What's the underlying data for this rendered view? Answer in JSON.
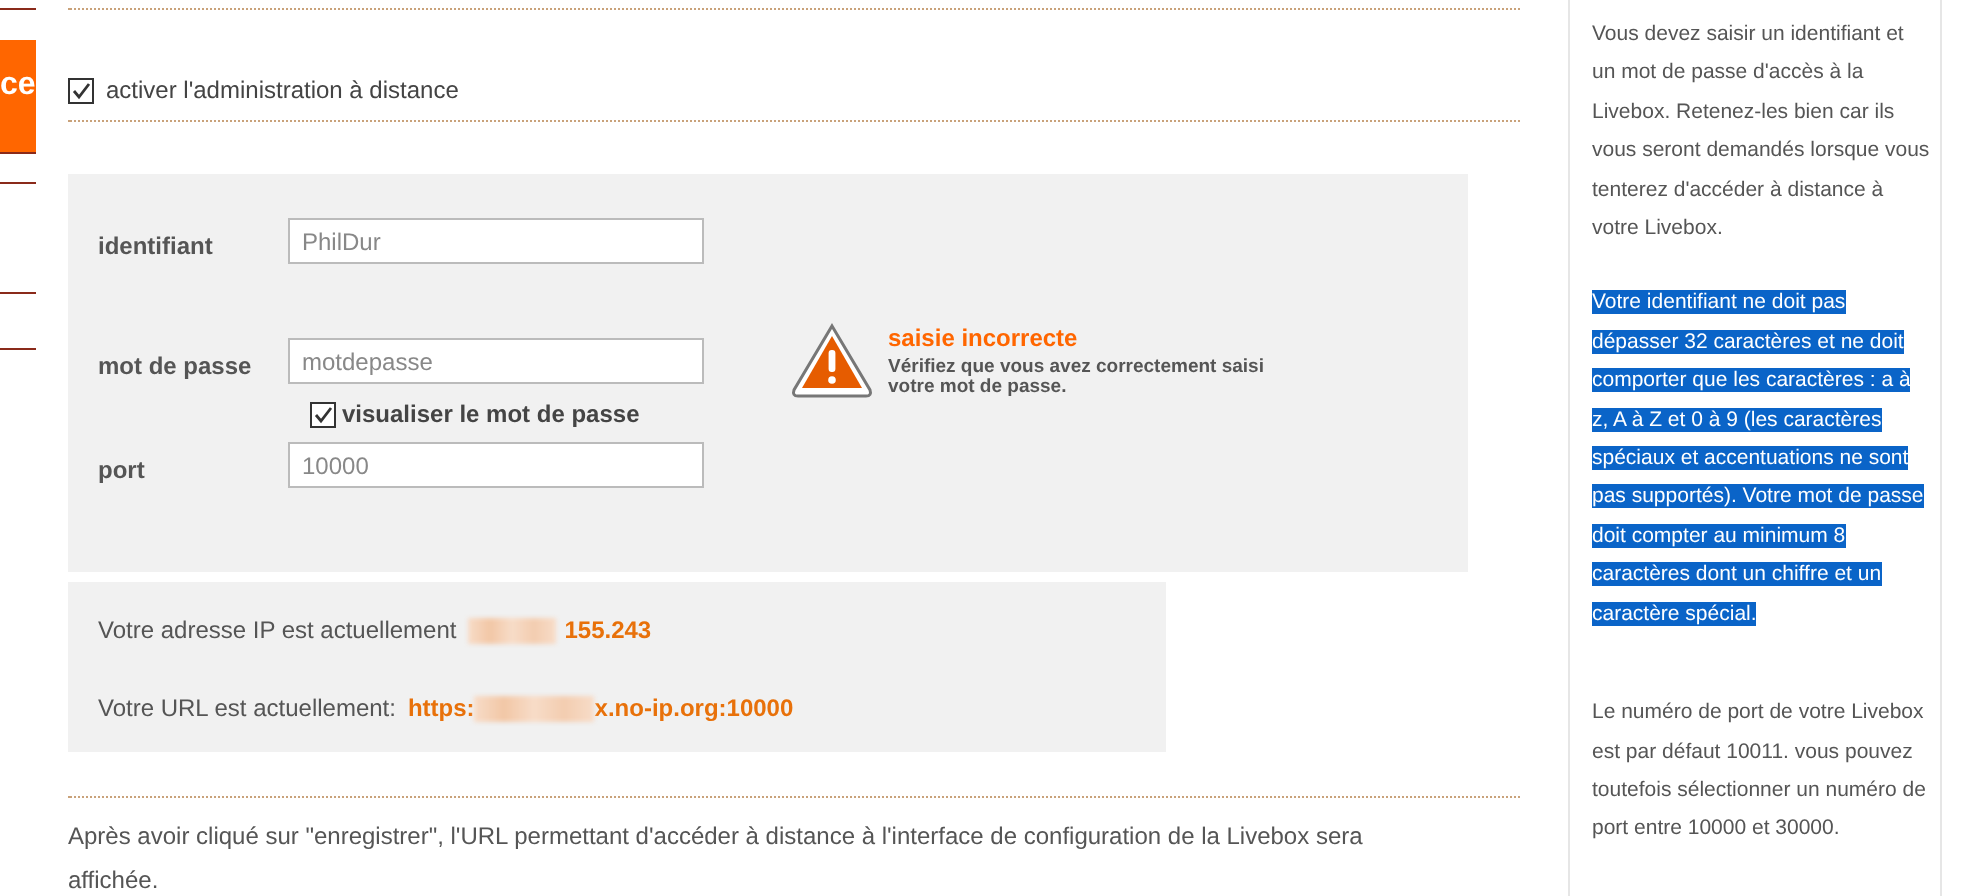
{
  "sidebar": {
    "active_tab": "ce"
  },
  "remote_admin": {
    "label": "activer l'administration à distance",
    "checked": true
  },
  "form": {
    "fields": [
      {
        "label": "identifiant",
        "value": "PhilDur"
      },
      {
        "label": "mot de passe",
        "value": "motdepasse"
      },
      {
        "label": "port",
        "value": "10000"
      }
    ],
    "show_password": {
      "label": "visualiser le mot de passe",
      "checked": true
    },
    "error": {
      "title": "saisie incorrecte",
      "message": "Vérifiez que vous avez correctement saisi votre mot de passe."
    }
  },
  "status": {
    "ip_label": "Votre adresse IP est actuellement",
    "ip_value": "155.243",
    "url_label": "Votre URL est actuellement:",
    "url_prefix": "https:",
    "url_suffix": "x.no-ip.org:10000"
  },
  "note": "Après avoir cliqué sur \"enregistrer\", l'URL permettant d'accéder à distance à l'interface de configuration de la Livebox sera affichée.",
  "help": [
    {
      "text": "Vous devez saisir un identifiant et un mot de passe d'accès à la Livebox. Retenez-les bien car ils vous seront demandés lorsque vous tenterez d'accéder à distance à votre Livebox.",
      "selected": false
    },
    {
      "text": "Votre identifiant ne doit pas dépasser 32 caractères et ne doit comporter que les caractères : a à z, A à Z et 0 à 9 (les caractères spéciaux et accentuations ne sont pas supportés). Votre mot de passe doit compter au minimum 8 caractères dont un chiffre et un caractère spécial.",
      "selected": true
    },
    {
      "text": "Le numéro de port de votre Livebox est par défaut 10011. vous pouvez toutefois sélectionner un numéro de port entre 10000 et 30000.",
      "selected": false
    }
  ]
}
